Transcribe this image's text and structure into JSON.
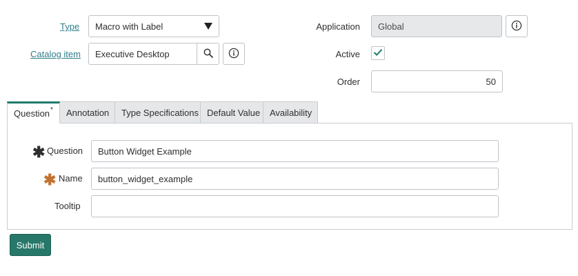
{
  "form": {
    "type_label": "Type",
    "type_value": "Macro with Label",
    "catalog_label": "Catalog item",
    "catalog_value": "Executive Desktop",
    "application_label": "Application",
    "application_value": "Global",
    "active_label": "Active",
    "active_checked": true,
    "order_label": "Order",
    "order_value": "50"
  },
  "tabs": [
    {
      "label": "Question",
      "required_mark": "*",
      "active": true
    },
    {
      "label": "Annotation"
    },
    {
      "label": "Type Specifications"
    },
    {
      "label": "Default Value"
    },
    {
      "label": "Availability"
    }
  ],
  "question_tab": {
    "question_label": "Question",
    "question_value": "Button Widget Example",
    "name_label": "Name",
    "name_value": "button_widget_example",
    "tooltip_label": "Tooltip",
    "tooltip_value": ""
  },
  "submit_label": "Submit",
  "icons": {
    "dropdown": "caret-down-icon",
    "search": "magnifier-icon",
    "info": "info-icon",
    "check": "checkmark-icon"
  },
  "colors": {
    "accent": "#28786a",
    "link": "#2e7d8c",
    "required_filled": "#2e2e2e",
    "required_empty": "#c2722e"
  }
}
